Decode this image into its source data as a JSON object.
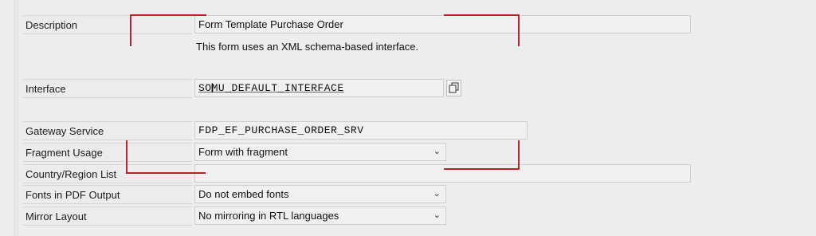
{
  "rows": {
    "description": {
      "label": "Description",
      "value": "Form Template Purchase Order"
    },
    "info_text": "This form uses an XML schema-based interface.",
    "interface": {
      "label": "Interface",
      "value": "SOMU_DEFAULT_INTERFACE"
    },
    "gateway_service": {
      "label": "Gateway Service",
      "value": "FDP_EF_PURCHASE_ORDER_SRV"
    },
    "fragment_usage": {
      "label": "Fragment Usage",
      "value": "Form with fragment"
    },
    "country_region_list": {
      "label": "Country/Region List",
      "value": ""
    },
    "fonts_in_pdf": {
      "label": "Fonts in PDF Output",
      "value": "Do not embed fonts"
    },
    "mirror_layout": {
      "label": "Mirror Layout",
      "value": "No mirroring in RTL languages"
    }
  },
  "icons": {
    "copy": "copy-icon",
    "dropdown": "chevron-down-icon",
    "cursor": "text-cursor-icon"
  },
  "colors": {
    "annotation": "#b8232a"
  }
}
